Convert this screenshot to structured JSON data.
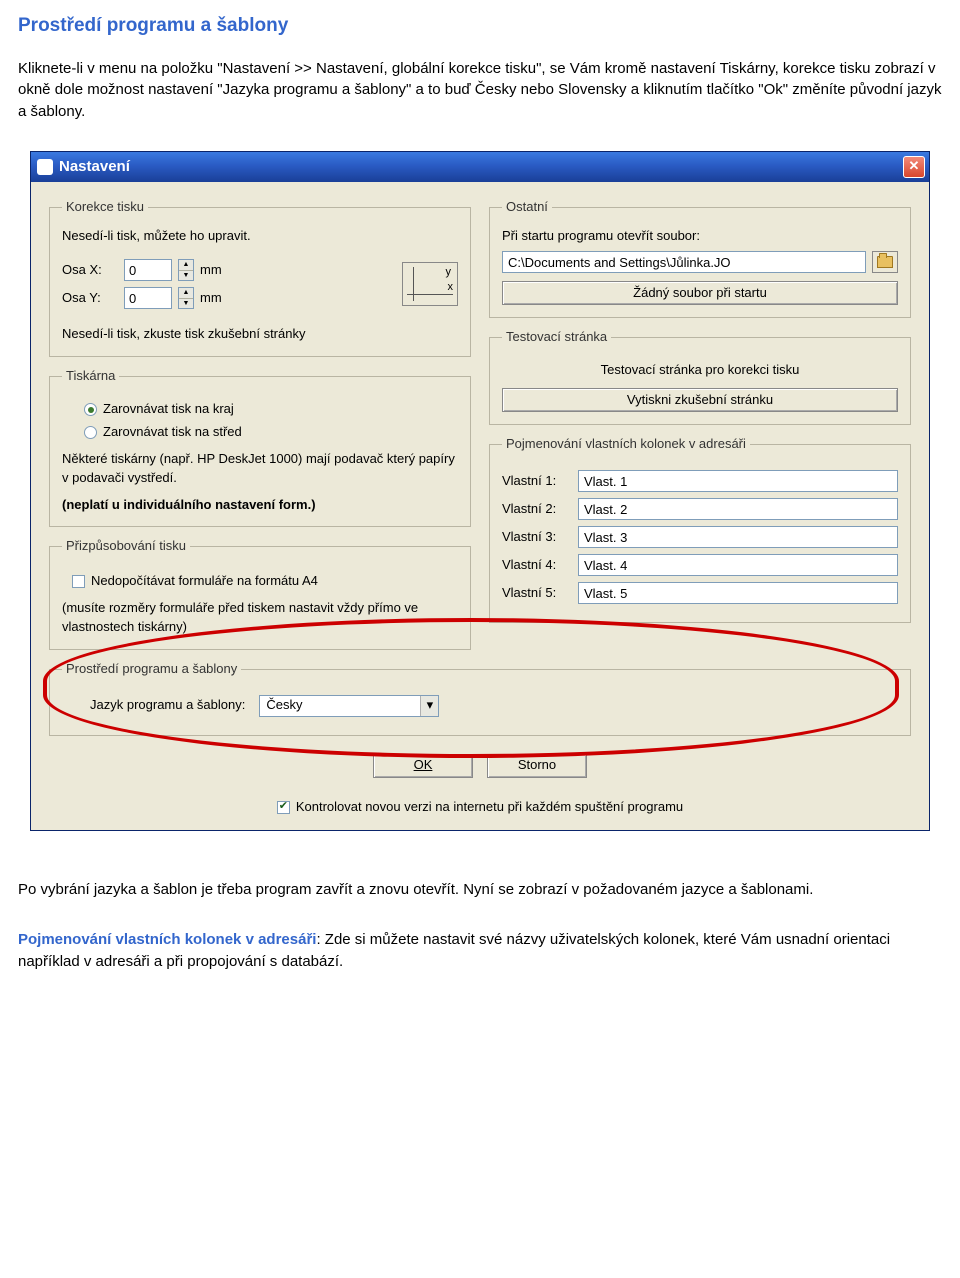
{
  "doc": {
    "title": "Prostředí programu a šablony",
    "para1": "Kliknete-li v menu na položku \"Nastavení >> Nastavení, globální korekce tisku\", se Vám kromě nastavení Tiskárny, korekce tisku zobrazí v okně dole možnost nastavení \"Jazyka programu a šablony\" a to buď Česky nebo Slovensky a kliknutím tlačítko \"Ok\" změníte původní jazyk a šablony.",
    "para2": "Po vybrání jazyka a šablon je třeba program zavřít a znovu otevřít. Nyní se zobrazí v požadovaném jazyce a šablonami.",
    "sub_title": "Pojmenování vlastních kolonek v adresáři",
    "para3": ": Zde si můžete nastavit své názvy uživatelských kolonek, které Vám usnadní orientaci například v adresáři a při propojování s databází."
  },
  "dialog": {
    "title": "Nastavení",
    "korekce": {
      "legend": "Korekce tisku",
      "note_top": "Nesedí-li tisk, můžete ho upravit.",
      "osa_x_label": "Osa X:",
      "osa_x_value": "0",
      "osa_y_label": "Osa Y:",
      "osa_y_value": "0",
      "unit": "mm",
      "note_bottom": "Nesedí-li tisk, zkuste tisk zkušební stránky",
      "axis_y": "y",
      "axis_x": "x"
    },
    "tiskarna": {
      "legend": "Tiskárna",
      "opt1": "Zarovnávat tisk na kraj",
      "opt2": "Zarovnávat tisk na střed",
      "note1": "Některé tiskárny (např. HP DeskJet 1000) mají podavač který papíry v podavači vystředí.",
      "note_bold": "(neplatí u individuálního nastavení form.)"
    },
    "prizp": {
      "legend": "Přizpůsobování tisku",
      "chk": "Nedopočítávat formuláře na formátu A4",
      "note": "(musíte rozměry formuláře před tiskem nastavit vždy přímo ve vlastnostech tiskárny)"
    },
    "ostatni": {
      "legend": "Ostatní",
      "open_label": "Při startu programu otevřít soubor:",
      "path_value": "C:\\Documents and Settings\\Jůlinka.JO",
      "no_file_btn": "Žádný soubor při startu"
    },
    "test": {
      "legend": "Testovací stránka",
      "text": "Testovací stránka pro korekci tisku",
      "btn": "Vytiskni zkušební stránku"
    },
    "pojm": {
      "legend": "Pojmenování vlastních kolonek v adresáři",
      "rows": [
        {
          "label": "Vlastní 1:",
          "value": "Vlast. 1"
        },
        {
          "label": "Vlastní 2:",
          "value": "Vlast. 2"
        },
        {
          "label": "Vlastní 3:",
          "value": "Vlast. 3"
        },
        {
          "label": "Vlastní 4:",
          "value": "Vlast. 4"
        },
        {
          "label": "Vlastní 5:",
          "value": "Vlast. 5"
        }
      ]
    },
    "env": {
      "legend": "Prostředí programu a šablony",
      "label": "Jazyk programu a šablony:",
      "value": "Česky"
    },
    "ok": "OK",
    "cancel": "Storno",
    "footer_chk": "Kontrolovat novou verzi na internetu při každém spuštění programu"
  }
}
